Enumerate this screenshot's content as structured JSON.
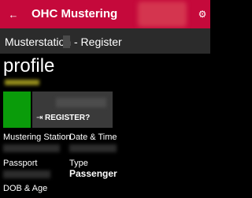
{
  "titlebar": {
    "back_icon": "←",
    "title": "OHC Mustering",
    "settings_icon": "⚙"
  },
  "subheader": {
    "station_label": "Musterstation",
    "page_label": "- Register"
  },
  "profile": {
    "heading": "profile",
    "register_icon": "⇥",
    "register_label": "REGISTER?"
  },
  "fields": {
    "mustering_station_label": "Mustering Station",
    "date_time_label": "Date & Time",
    "passport_label": "Passport",
    "type_label": "Type",
    "type_value": "Passenger",
    "dob_age_label": "DOB & Age"
  },
  "colors": {
    "accent": "#c5093b",
    "subheader": "#2b2b2b",
    "photo_tile": "#0a9c0a",
    "register_tile": "#3a3a3a"
  }
}
